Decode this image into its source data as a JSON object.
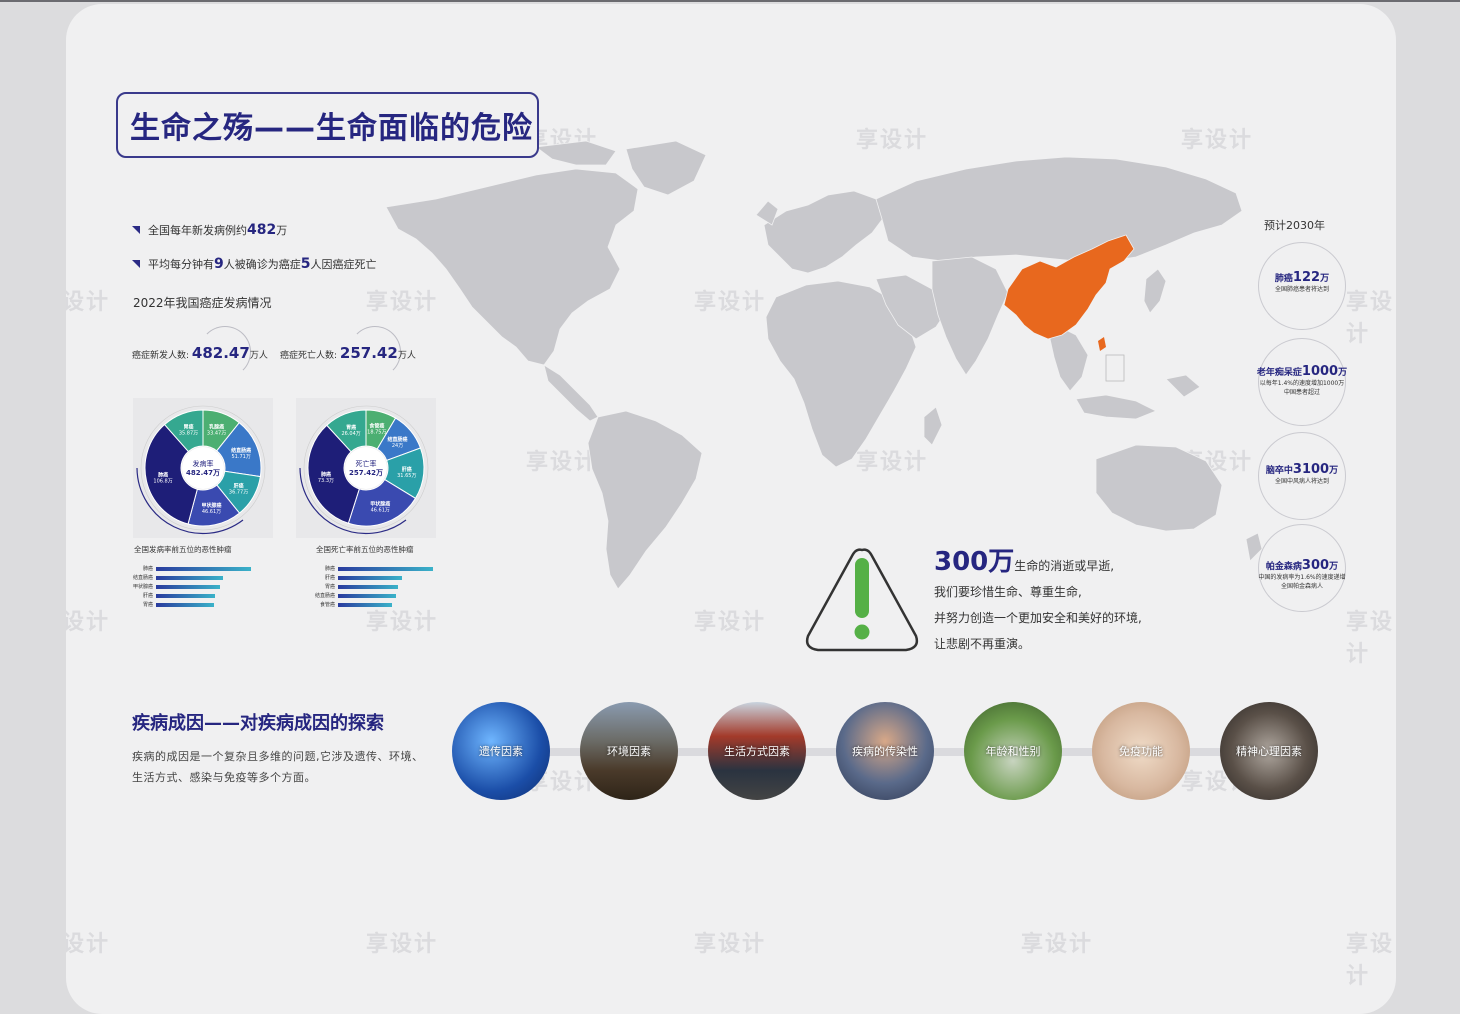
{
  "title": "生命之殇——生命面临的危险",
  "stats": [
    {
      "pre": "全国每年新发病例约",
      "num": "482",
      "post": "万"
    },
    {
      "pre": "平均每分钟有",
      "num": "9",
      "mid": "人被确诊为癌症",
      "num2": "5",
      "post": "人因癌症死亡"
    }
  ],
  "subhead": "2022年我国癌症发病情况",
  "counts": [
    {
      "label": "癌症新发人数:",
      "value": "482.47",
      "unit": "万人"
    },
    {
      "label": "癌症死亡人数:",
      "value": "257.42",
      "unit": "万人"
    }
  ],
  "chart_data": [
    {
      "type": "pie",
      "center_label": "发病率",
      "center_value": "482.47万",
      "categories": [
        "乳腺癌",
        "结直肠癌",
        "肝癌",
        "甲状腺癌",
        "肺癌",
        "胃癌"
      ],
      "value_labels": [
        "33.47万",
        "51.71万",
        "36.77万",
        "46.61万",
        "106.8万",
        "35.87万"
      ],
      "values": [
        33.47,
        51.71,
        36.77,
        46.61,
        106.8,
        35.87
      ],
      "colors": [
        "#4caf72",
        "#3a78c8",
        "#2aa0a8",
        "#3a4ab0",
        "#1e1e78",
        "#35a890"
      ],
      "caption": "全国发病率前五位的恶性肿瘤",
      "bar_categories": [
        "肺癌",
        "结直肠癌",
        "甲状腺癌",
        "肝癌",
        "胃癌"
      ],
      "bar_values": [
        106.8,
        51.71,
        46.61,
        36.77,
        35.87
      ]
    },
    {
      "type": "pie",
      "center_label": "死亡率",
      "center_value": "257.42万",
      "categories": [
        "食管癌",
        "结直肠癌",
        "肝癌",
        "甲状腺癌",
        "肺癌",
        "胃癌"
      ],
      "value_labels": [
        "18.75万",
        "24万",
        "31.65万",
        "46.61万",
        "73.3万",
        "26.04万"
      ],
      "values": [
        18.75,
        24,
        31.65,
        46.61,
        73.3,
        26.04
      ],
      "colors": [
        "#4caf72",
        "#3a78c8",
        "#2aa0a8",
        "#3a4ab0",
        "#1e1e78",
        "#35a890"
      ],
      "caption": "全国死亡率前五位的恶性肿瘤",
      "bar_categories": [
        "肺癌",
        "肝癌",
        "胃癌",
        "结直肠癌",
        "食管癌"
      ],
      "bar_values": [
        73.3,
        31.65,
        26.04,
        24,
        18.75
      ]
    }
  ],
  "future": {
    "title": "预计2030年",
    "items": [
      {
        "pre": "肺癌",
        "num": "122",
        "unit": "万",
        "desc": "全国肺癌患者将达到"
      },
      {
        "pre": "老年痴呆症",
        "num": "1000",
        "unit": "万",
        "desc": "以每年1.4%的速度增加1000万",
        "desc2": "中国患者超过"
      },
      {
        "pre": "脑卒中",
        "num": "3100",
        "unit": "万",
        "desc": "全国中风病人将达到"
      },
      {
        "pre": "帕金森病",
        "num": "300",
        "unit": "万",
        "desc": "中国的发病率为1.6%的速度递增",
        "desc2": "全国帕金森病人"
      }
    ]
  },
  "message": {
    "big": "300万",
    "line1": "生命的消逝或早逝,",
    "line2": "我们要珍惜生命、尊重生命,",
    "line3": "并努力创造一个更加安全和美好的环境,",
    "line4": "让悲剧不再重演。"
  },
  "causes": {
    "title": "疾病成因——对疾病成因的探索",
    "desc": "疾病的成因是一个复杂且多维的问题,它涉及遗传、环境、生活方式、感染与免疫等多个方面。",
    "items": [
      "遗传因素",
      "环境因素",
      "生活方式因素",
      "疾病的传染性",
      "年龄和性别",
      "免疫功能",
      "精神心理因素"
    ]
  },
  "watermark": "享设计",
  "colors": {
    "accent": "#262680",
    "china": "#e8681e",
    "map": "#c8c8cc",
    "warn": "#55b046"
  }
}
